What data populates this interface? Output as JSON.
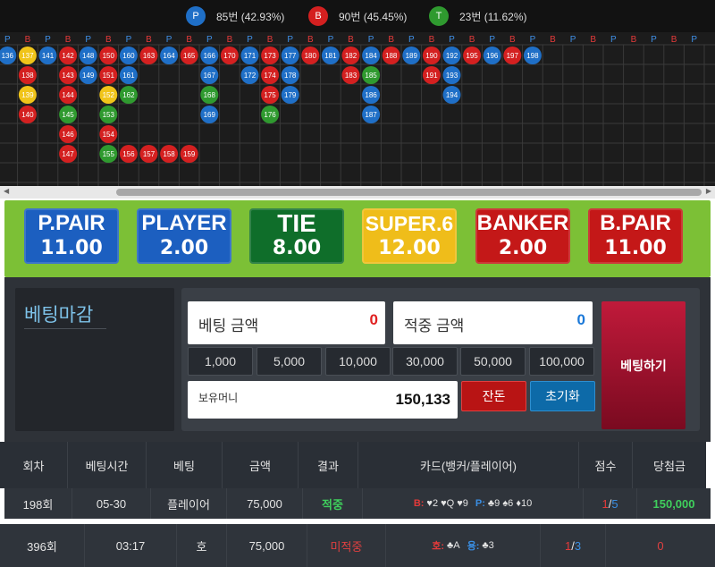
{
  "stats": {
    "player": {
      "badge": "P",
      "text": "85번 (42.93%)",
      "color": "#1f6fc7"
    },
    "banker": {
      "badge": "B",
      "text": "90번 (45.45%)",
      "color": "#d42020"
    },
    "tie": {
      "badge": "T",
      "text": "23번 (11.62%)",
      "color": "#2f9a2f"
    }
  },
  "road": {
    "header": [
      "P",
      "B",
      "P",
      "B",
      "P",
      "B",
      "P",
      "B",
      "P",
      "B",
      "P",
      "B",
      "P",
      "B",
      "P",
      "B",
      "P",
      "B",
      "P",
      "B",
      "P",
      "B",
      "P",
      "B",
      "P",
      "B",
      "P",
      "B",
      "P",
      "B",
      "P",
      "B",
      "P",
      "B",
      "P"
    ],
    "columns": [
      [
        {
          "n": "136",
          "c": "P"
        }
      ],
      [
        {
          "n": "137",
          "c": "T"
        },
        {
          "n": "138",
          "c": "B"
        },
        {
          "n": "139",
          "c": "T"
        },
        {
          "n": "140",
          "c": "B"
        }
      ],
      [
        {
          "n": "141",
          "c": "P"
        }
      ],
      [
        {
          "n": "142",
          "c": "B"
        },
        {
          "n": "143",
          "c": "B"
        },
        {
          "n": "144",
          "c": "B"
        },
        {
          "n": "145",
          "c": "G"
        },
        {
          "n": "146",
          "c": "B"
        },
        {
          "n": "147",
          "c": "B"
        }
      ],
      [
        {
          "n": "148",
          "c": "P"
        },
        {
          "n": "149",
          "c": "P"
        }
      ],
      [
        {
          "n": "150",
          "c": "B"
        },
        {
          "n": "151",
          "c": "B"
        },
        {
          "n": "152",
          "c": "T"
        },
        {
          "n": "153",
          "c": "G"
        },
        {
          "n": "154",
          "c": "B"
        },
        {
          "n": "155",
          "c": "G"
        }
      ],
      [
        {
          "n": "160",
          "c": "P"
        },
        {
          "n": "161",
          "c": "P"
        },
        {
          "n": "162",
          "c": "G"
        },
        null,
        null,
        {
          "n": "156",
          "c": "B"
        }
      ],
      [
        {
          "n": "163",
          "c": "B"
        },
        null,
        null,
        null,
        null,
        {
          "n": "157",
          "c": "B"
        }
      ],
      [
        {
          "n": "164",
          "c": "P"
        },
        null,
        null,
        null,
        null,
        {
          "n": "158",
          "c": "B"
        }
      ],
      [
        {
          "n": "165",
          "c": "B"
        },
        null,
        null,
        null,
        null,
        {
          "n": "159",
          "c": "B"
        }
      ],
      [
        {
          "n": "166",
          "c": "P"
        },
        {
          "n": "167",
          "c": "P"
        },
        {
          "n": "168",
          "c": "G"
        },
        {
          "n": "169",
          "c": "P"
        }
      ],
      [
        {
          "n": "170",
          "c": "B"
        }
      ],
      [
        {
          "n": "171",
          "c": "P"
        },
        {
          "n": "172",
          "c": "P"
        }
      ],
      [
        {
          "n": "173",
          "c": "B"
        },
        {
          "n": "174",
          "c": "B"
        },
        {
          "n": "175",
          "c": "B"
        },
        {
          "n": "176",
          "c": "G"
        }
      ],
      [
        {
          "n": "177",
          "c": "P"
        },
        {
          "n": "178",
          "c": "P"
        },
        {
          "n": "179",
          "c": "P"
        }
      ],
      [
        {
          "n": "180",
          "c": "B"
        }
      ],
      [
        {
          "n": "181",
          "c": "P"
        }
      ],
      [
        {
          "n": "182",
          "c": "B"
        },
        {
          "n": "183",
          "c": "B"
        }
      ],
      [
        {
          "n": "184",
          "c": "P"
        },
        {
          "n": "185",
          "c": "G"
        },
        {
          "n": "186",
          "c": "P"
        },
        {
          "n": "187",
          "c": "P"
        }
      ],
      [
        {
          "n": "188",
          "c": "B"
        }
      ],
      [
        {
          "n": "189",
          "c": "P"
        }
      ],
      [
        {
          "n": "190",
          "c": "B"
        },
        {
          "n": "191",
          "c": "B"
        }
      ],
      [
        {
          "n": "192",
          "c": "P"
        },
        {
          "n": "193",
          "c": "P"
        },
        {
          "n": "194",
          "c": "P"
        }
      ],
      [
        {
          "n": "195",
          "c": "B"
        }
      ],
      [
        {
          "n": "196",
          "c": "P"
        }
      ],
      [
        {
          "n": "197",
          "c": "B"
        }
      ],
      [
        {
          "n": "198",
          "c": "P"
        }
      ]
    ]
  },
  "bets": [
    {
      "name": "P.PAIR",
      "odds": "11.00",
      "bg": "#1c5fc0",
      "fg": "#fff"
    },
    {
      "name": "PLAYER",
      "odds": "2.00",
      "bg": "#1c5fc0",
      "fg": "#fff"
    },
    {
      "name": "TIE",
      "odds": "8.00",
      "bg": "#0f6e2a",
      "fg": "#fff"
    },
    {
      "name": "SUPER.6",
      "odds": "12.00",
      "bg": "#efbd1a",
      "fg": "#fff"
    },
    {
      "name": "BANKER",
      "odds": "2.00",
      "bg": "#c41818",
      "fg": "#fff"
    },
    {
      "name": "B.PAIR",
      "odds": "11.00",
      "bg": "#c41818",
      "fg": "#fff"
    }
  ],
  "panel": {
    "closed_label": "베팅마감",
    "bet_amount_label": "베팅 금액",
    "bet_amount_value": "0",
    "hit_amount_label": "적중 금액",
    "hit_amount_value": "0",
    "chips": [
      "1,000",
      "5,000",
      "10,000",
      "30,000",
      "50,000",
      "100,000"
    ],
    "balance_label": "보유머니",
    "balance_value": "150,133",
    "change_label": "잔돈",
    "reset_label": "초기화",
    "bet_button": "베팅하기"
  },
  "table": {
    "headers": [
      "회차",
      "베팅시간",
      "베팅",
      "금액",
      "결과",
      "카드(뱅커/플레이어)",
      "점수",
      "당첨금"
    ],
    "rows": [
      {
        "round": "198회",
        "time": "05-30",
        "bet": "플레이어",
        "amount": "75,000",
        "result": "적중",
        "cards_b": "B:",
        "cards_b_val": "♥2 ♥Q ♥9",
        "cards_p": "P:",
        "cards_p_val": "♣9 ♠6 ♦10",
        "score_a": "1",
        "score_sep": "/",
        "score_b": "5",
        "prize": "150,000"
      },
      {
        "round": "396회",
        "time": "03:17",
        "bet": "호",
        "amount": "75,000",
        "result": "미적중",
        "cards_b": "호:",
        "cards_b_val": "♣A",
        "cards_p": "용:",
        "cards_p_val": "♣3",
        "score_a": "1",
        "score_sep": "/",
        "score_b": "3",
        "prize": "0"
      }
    ]
  }
}
